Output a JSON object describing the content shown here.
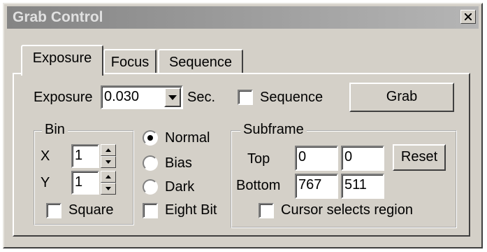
{
  "window": {
    "title": "Grab Control"
  },
  "tabs": [
    {
      "label": "Exposure",
      "active": true
    },
    {
      "label": "Focus",
      "active": false
    },
    {
      "label": "Sequence",
      "active": false
    }
  ],
  "exposure": {
    "label": "Exposure",
    "value": "0.030",
    "unit": "Sec.",
    "sequence_label": "Sequence",
    "sequence_checked": false,
    "grab_label": "Grab"
  },
  "bin": {
    "title": "Bin",
    "x_label": "X",
    "x_value": "1",
    "y_label": "Y",
    "y_value": "1",
    "square_label": "Square",
    "square_checked": false
  },
  "mode": {
    "options": [
      "Normal",
      "Bias",
      "Dark"
    ],
    "selected": "Normal",
    "eight_bit_label": "Eight Bit",
    "eight_bit_checked": false
  },
  "subframe": {
    "title": "Subframe",
    "top_label": "Top",
    "top_values": [
      "0",
      "0"
    ],
    "bottom_label": "Bottom",
    "bottom_values": [
      "767",
      "511"
    ],
    "reset_label": "Reset",
    "cursor_label": "Cursor selects region",
    "cursor_checked": false
  },
  "icons": {
    "close": "close-icon",
    "dropdown": "chevron-down-icon",
    "spin_up": "spin-up-icon",
    "spin_down": "spin-down-icon"
  }
}
